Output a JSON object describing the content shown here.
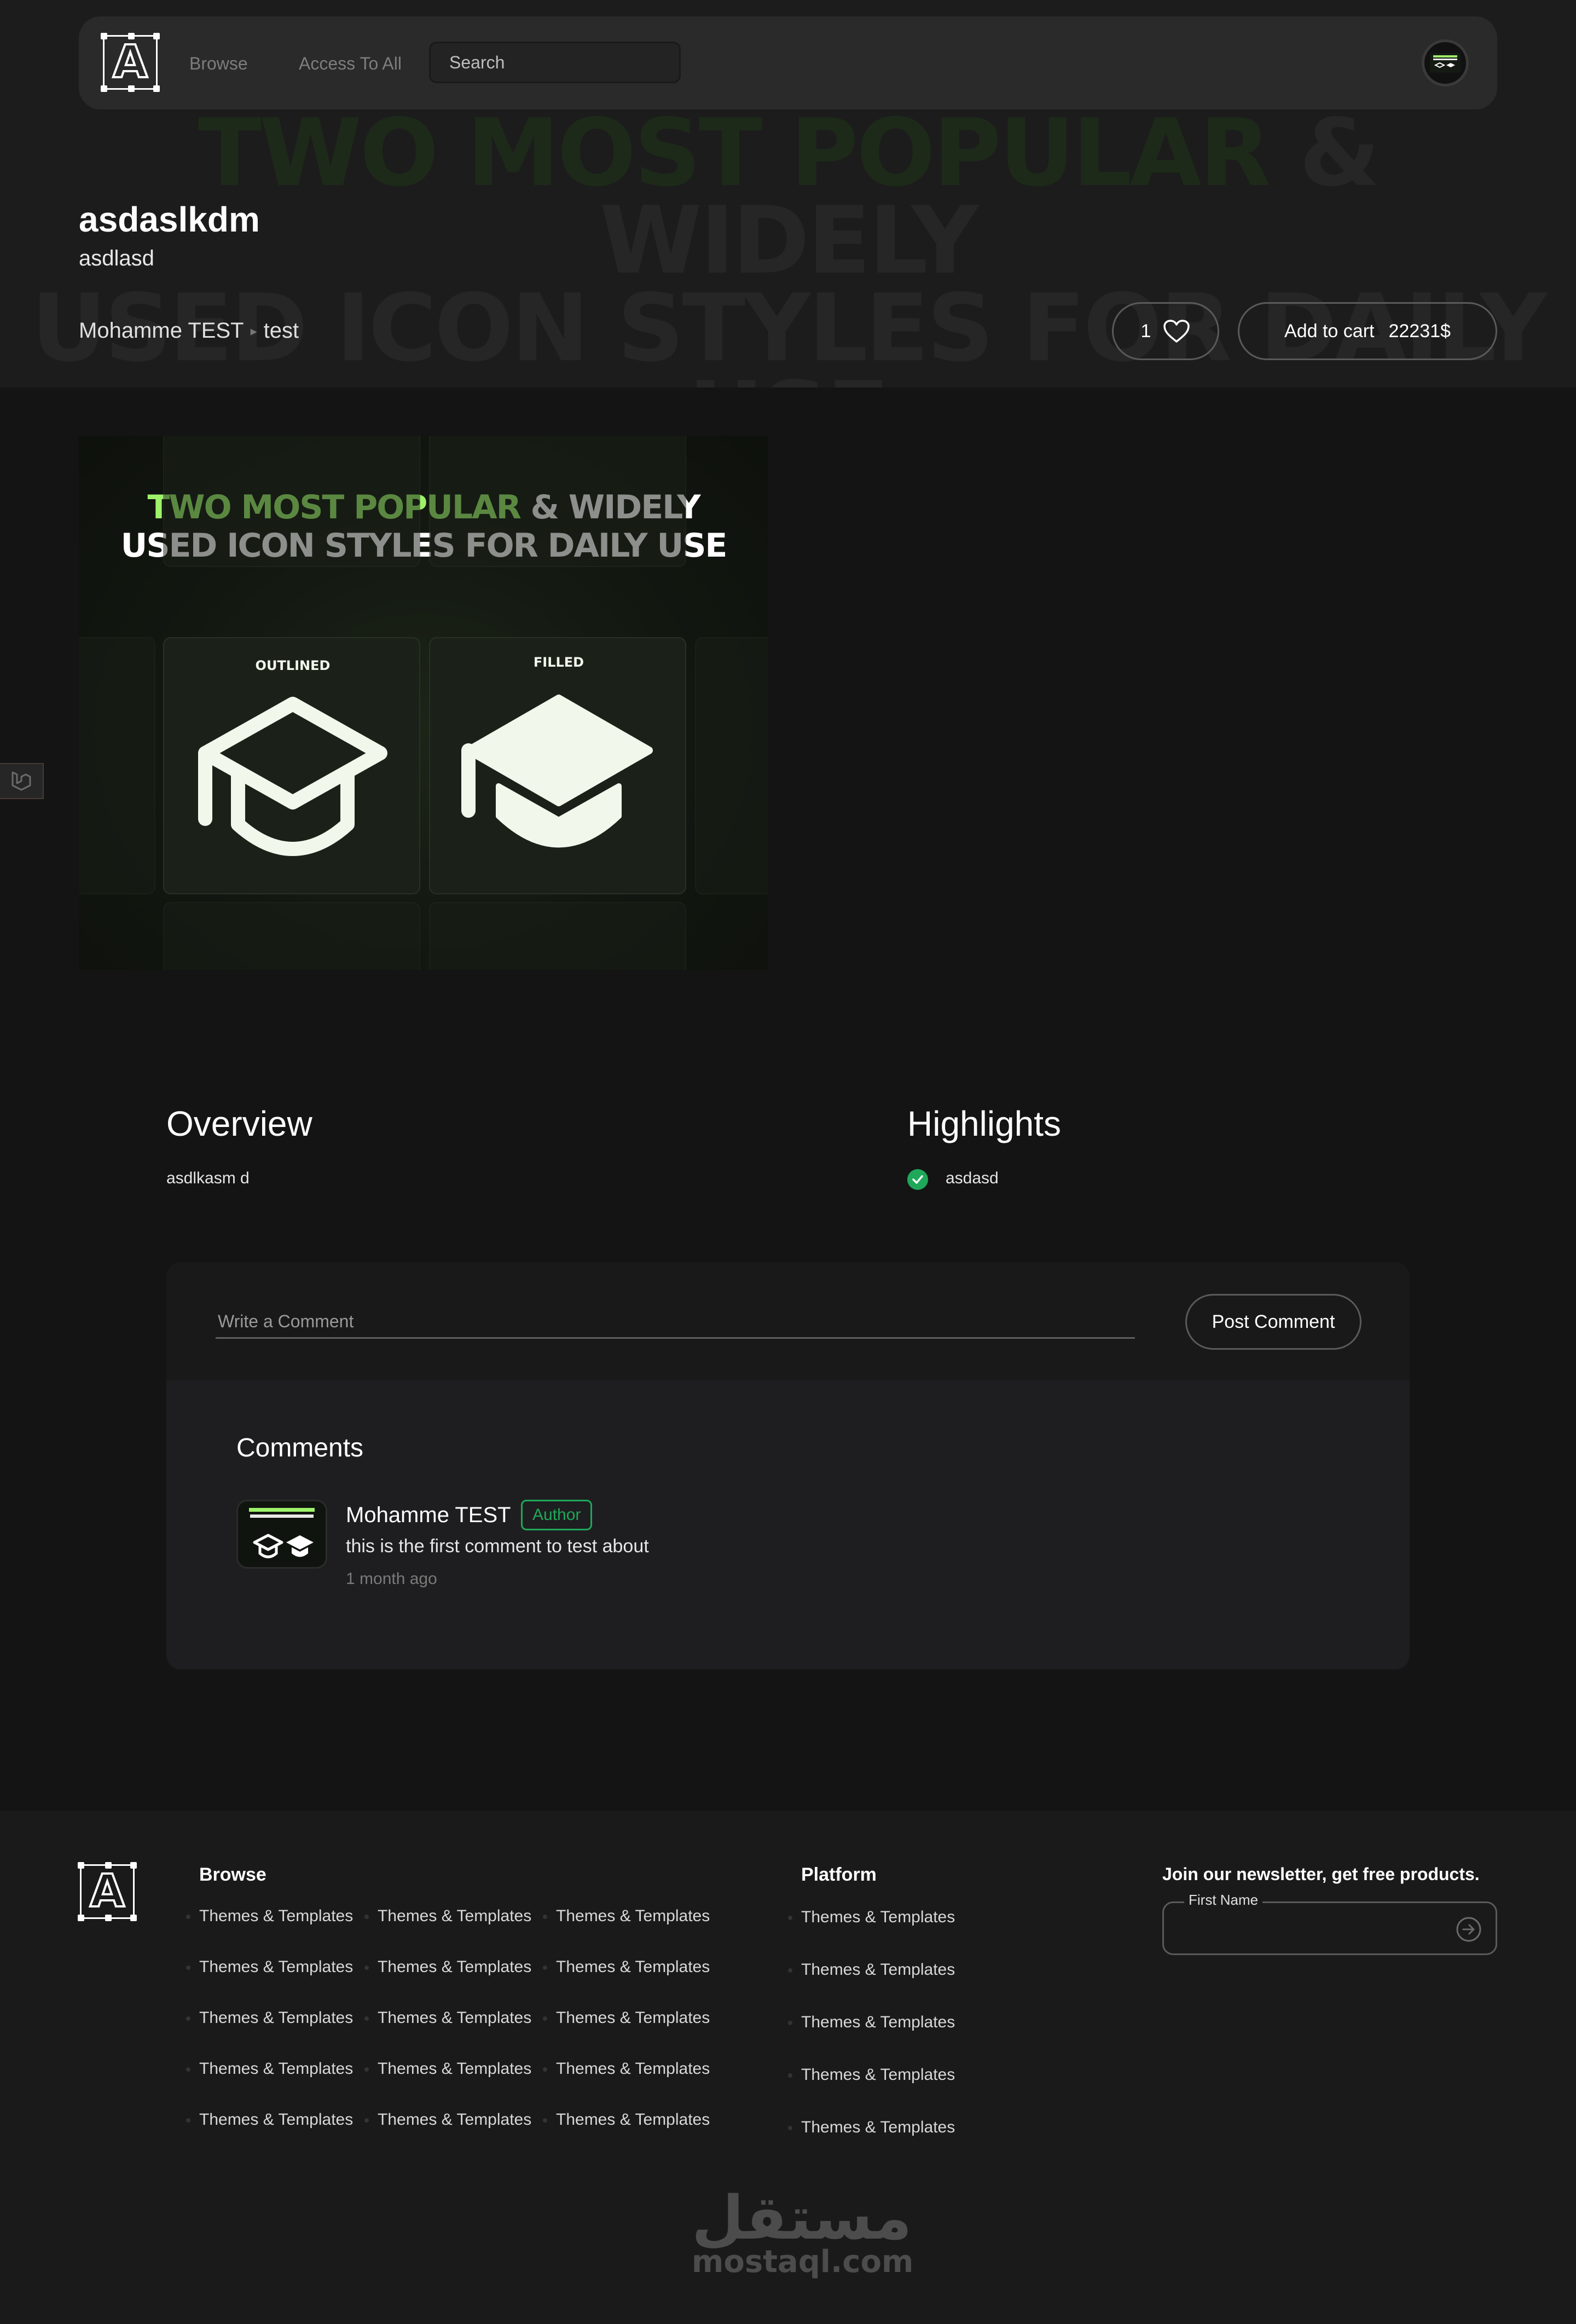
{
  "nav": {
    "links": [
      "Browse",
      "Access To All"
    ],
    "search_placeholder": "Search"
  },
  "hero": {
    "bg_line1_green": "TWO MOST POPULAR",
    "bg_line1_rest": " & WIDELY",
    "bg_line2": "USED ICON STYLES FOR DAILY USE",
    "title": "asdaslkdm",
    "subtitle": "asdlasd",
    "breadcrumb": [
      "Mohamme TEST",
      "test"
    ],
    "likes": "1",
    "cart_label": "Add to cart",
    "price": "22231$"
  },
  "product_image": {
    "headline_green": "TWO MOST POPULAR",
    "headline_rest": " & WIDELY",
    "headline_line2": "USED ICON STYLES FOR DAILY USE",
    "tile_labels": [
      "OUTLINED",
      "FILLED"
    ]
  },
  "overview": {
    "heading": "Overview",
    "text": "asdlkasm d"
  },
  "highlights": {
    "heading": "Highlights",
    "items": [
      "asdasd"
    ]
  },
  "comment_form": {
    "placeholder": "Write a Comment",
    "submit": "Post Comment"
  },
  "comments": {
    "heading": "Comments",
    "items": [
      {
        "author": "Mohamme TEST",
        "badge": "Author",
        "text": "this is the first comment to test about",
        "time": "1 month ago"
      }
    ]
  },
  "footer": {
    "browse_heading": "Browse",
    "browse_links": [
      "Themes & Templates",
      "Themes & Templates",
      "Themes & Templates",
      "Themes & Templates",
      "Themes & Templates",
      "Themes & Templates",
      "Themes & Templates",
      "Themes & Templates",
      "Themes & Templates",
      "Themes & Templates",
      "Themes & Templates",
      "Themes & Templates",
      "Themes & Templates",
      "Themes & Templates",
      "Themes & Templates"
    ],
    "platform_heading": "Platform",
    "platform_links": [
      "Themes & Templates",
      "Themes & Templates",
      "Themes & Templates",
      "Themes & Templates",
      "Themes & Templates"
    ],
    "newsletter_heading": "Join our newsletter, get free products.",
    "newsletter_label": "First Name"
  },
  "watermark": {
    "arabic": "مستقل",
    "latin": "mostaql.com"
  },
  "colors": {
    "accent_green": "#9ef26a",
    "success": "#1fa75a",
    "background": "#141414"
  },
  "icons": [
    "logo-a-icon",
    "heart-icon",
    "laravel-icon",
    "check-icon",
    "arrow-right-circle-icon",
    "graduation-cap-outline-icon",
    "graduation-cap-filled-icon"
  ]
}
